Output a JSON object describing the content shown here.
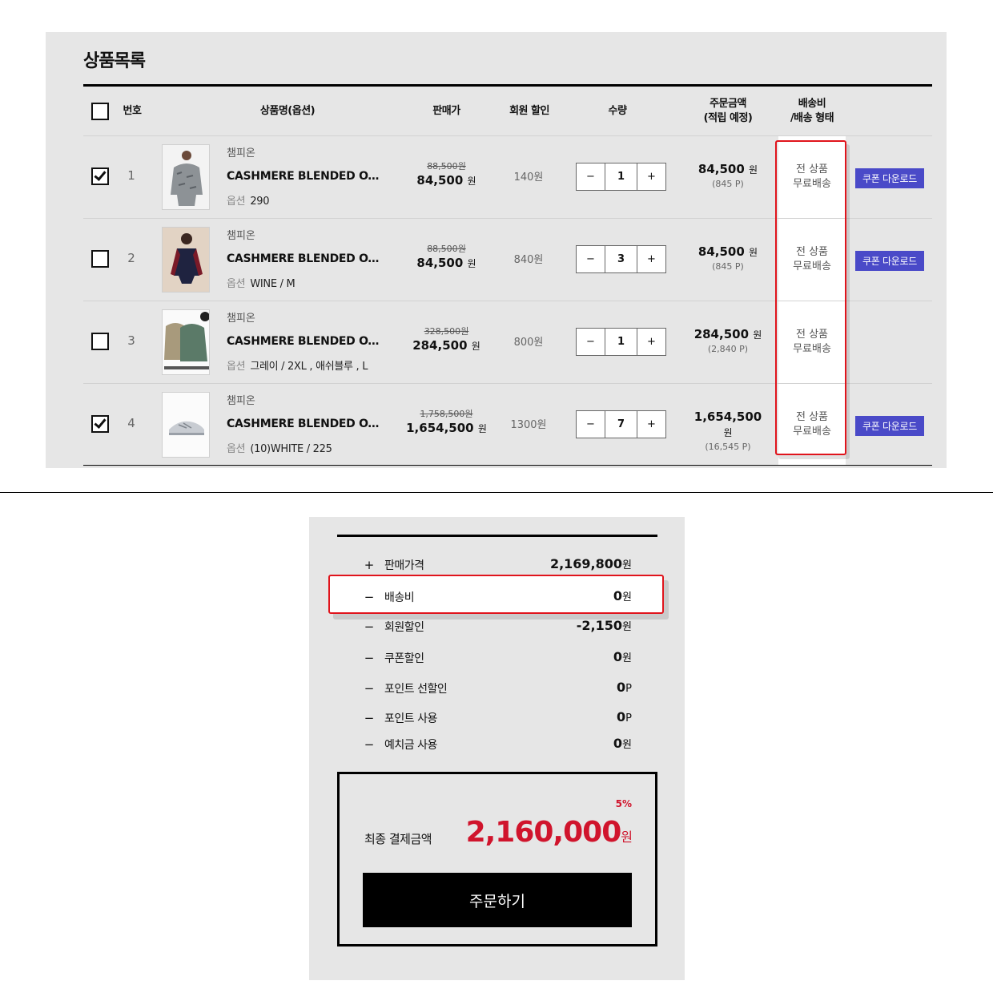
{
  "cart": {
    "title": "상품목록",
    "headers": {
      "no": "번호",
      "name": "상품명(옵션)",
      "price": "판매가",
      "member_discount": "회원 할인",
      "qty": "수량",
      "order_amount_1": "주문금액",
      "order_amount_2": "(적립 예정)",
      "shipping_1": "배송비",
      "shipping_2": "/배송 형태"
    },
    "option_label": "옵션",
    "won": "원",
    "minus": "−",
    "plus": "+",
    "items": [
      {
        "no": "1",
        "checked": true,
        "brand": "챔피온",
        "name": "CASHMERE BLENDED OVERSIZED",
        "option": "290",
        "orig_price": "88,500",
        "price": "84,500",
        "member_discount": "140원",
        "qty": "1",
        "amount": "84,500",
        "points": "(845 P)",
        "ship_1": "전 상품",
        "ship_2": "무료배송",
        "coupon": "쿠폰 다운로드"
      },
      {
        "no": "2",
        "checked": false,
        "brand": "챔피온",
        "name": "CASHMERE BLENDED OVERSIZED",
        "option": "WINE / M",
        "orig_price": "88,500",
        "price": "84,500",
        "member_discount": "840원",
        "qty": "3",
        "amount": "84,500",
        "points": "(845 P)",
        "ship_1": "전 상품",
        "ship_2": "무료배송",
        "coupon": "쿠폰 다운로드"
      },
      {
        "no": "3",
        "checked": false,
        "brand": "챔피온",
        "name": "CASHMERE BLENDED OVERSIZED",
        "option": "그레이 / 2XL , 애쉬블루 , L",
        "orig_price": "328,500",
        "price": "284,500",
        "member_discount": "800원",
        "qty": "1",
        "amount": "284,500",
        "points": "(2,840 P)",
        "ship_1": "전 상품",
        "ship_2": "무료배송",
        "coupon": ""
      },
      {
        "no": "4",
        "checked": true,
        "brand": "챔피온",
        "name": "CASHMERE BLENDED OVERSIZED",
        "option": "(10)WHITE / 225",
        "orig_price": "1,758,500",
        "price": "1,654,500",
        "member_discount": "1300원",
        "qty": "7",
        "amount": "1,654,500",
        "points": "(16,545 P)",
        "ship_1": "전 상품",
        "ship_2": "무료배송",
        "coupon": "쿠폰 다운로드"
      }
    ]
  },
  "summary": {
    "lines": [
      {
        "sign": "+",
        "label": "판매가격",
        "value": "2,169,800",
        "unit": "원"
      },
      {
        "sign": "−",
        "label": "배송비",
        "value": "0",
        "unit": "원"
      },
      {
        "sign": "−",
        "label": "회원할인",
        "value": "-2,150",
        "unit": "원"
      },
      {
        "sign": "−",
        "label": "쿠폰할인",
        "value": "0",
        "unit": "원"
      },
      {
        "sign": "−",
        "label": "포인트 선할인",
        "value": "0",
        "unit": "P"
      },
      {
        "sign": "−",
        "label": "포인트 사용",
        "value": "0",
        "unit": "P"
      },
      {
        "sign": "−",
        "label": "예치금 사용",
        "value": "0",
        "unit": "원"
      }
    ],
    "rate": "5%",
    "final_label": "최종 결제금액",
    "final_value": "2,160,000",
    "final_unit": "원",
    "order_button": "주문하기"
  }
}
